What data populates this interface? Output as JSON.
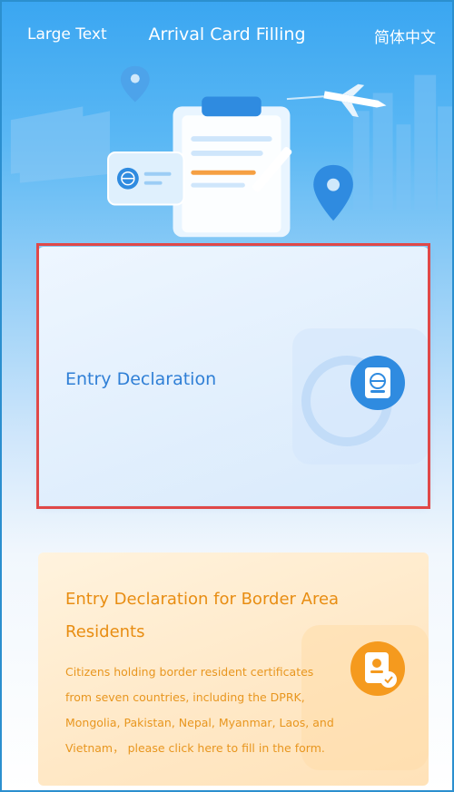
{
  "header": {
    "large_text": "Large Text",
    "title": "Arrival Card Filling",
    "language": "简体中文"
  },
  "cards": [
    {
      "label": "Entry Declaration"
    },
    {
      "label": "Entry Declaration for Border Area Residents",
      "description": "Citizens holding border resident certificates from seven countries, including the DPRK, Mongolia, Pakistan, Nepal, Myanmar, Laos, and Vietnam， please click here to fill in the form."
    }
  ],
  "colors": {
    "header_blue": "#3aa6f1",
    "entry_text": "#2f7fd6",
    "border_text": "#e88d12",
    "highlight_outline": "#e04848"
  }
}
